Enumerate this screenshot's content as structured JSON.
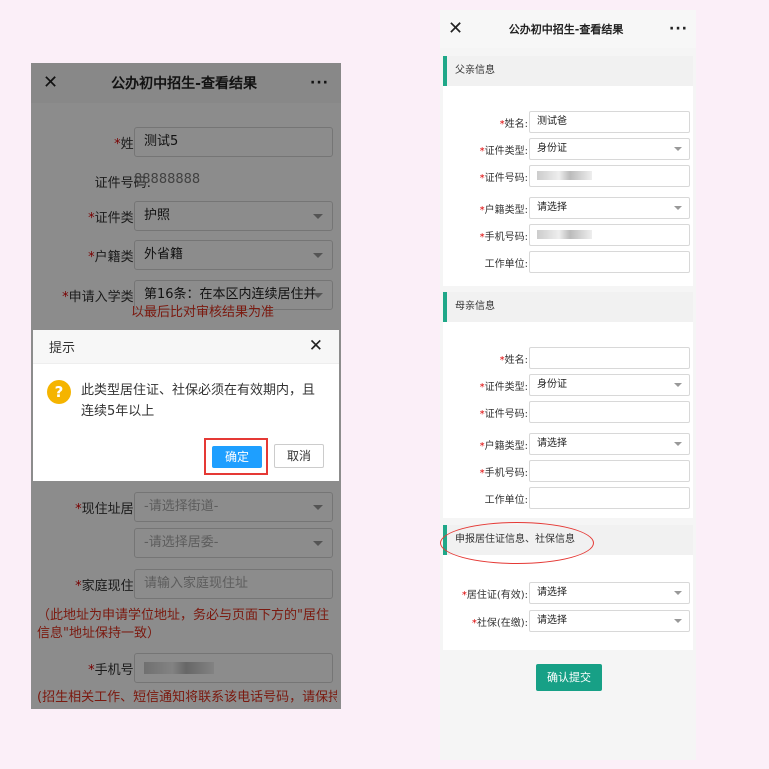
{
  "left": {
    "nav": {
      "close": "✕",
      "title": "公办初中招生-查看结果",
      "more": "···"
    },
    "form": {
      "name_label": "姓名:",
      "name_value": "测试5",
      "id_no_label": "证件号码:",
      "id_no_value": "88888888",
      "id_type_label": "证件类型:",
      "id_type_value": "护照",
      "hukou_label": "户籍类型:",
      "hukou_value": "外省籍",
      "apply_label": "申请入学类型:",
      "apply_value": "第16条：在本区内连续居住并",
      "compare_note": "以最后比对审核结果为准",
      "residence_label": "现住址居委:",
      "street_placeholder": "-请选择街道-",
      "committee_placeholder": "-请选择居委-",
      "address_label": "家庭现住址:",
      "address_placeholder": "请输入家庭现住址",
      "address_note": "（此地址为申请学位地址，务必与页面下方的\"居住信息\"地址保持一致）",
      "phone_label": "手机号码:",
      "phone_note": "(招生相关工作、短信通知将联系该电话号码，请保持畅"
    },
    "dialog": {
      "title": "提示",
      "close": "✕",
      "icon": "?",
      "message": "此类型居住证、社保必须在有效期内，且连续5年以上",
      "ok": "确定",
      "cancel": "取消"
    }
  },
  "right": {
    "nav": {
      "close": "✕",
      "title": "公办初中招生-查看结果",
      "more": "···"
    },
    "father": {
      "header": "父亲信息",
      "name_label": "姓名:",
      "name_value": "测试爸",
      "id_type_label": "证件类型:",
      "id_type_value": "身份证",
      "id_no_label": "证件号码:",
      "hukou_label": "户籍类型:",
      "hukou_placeholder": "请选择",
      "phone_label": "手机号码:",
      "work_label": "工作单位:"
    },
    "mother": {
      "header": "母亲信息",
      "name_label": "姓名:",
      "id_type_label": "证件类型:",
      "id_type_value": "身份证",
      "id_no_label": "证件号码:",
      "hukou_label": "户籍类型:",
      "hukou_placeholder": "请选择",
      "phone_label": "手机号码:",
      "work_label": "工作单位:"
    },
    "residence": {
      "header": "申报居住证信息、社保信息",
      "permit_label": "居住证(有效):",
      "permit_placeholder": "请选择",
      "social_label": "社保(在缴):",
      "social_placeholder": "请选择"
    },
    "submit": "确认提交"
  },
  "colors": {
    "accent": "#1ea888",
    "ok_button": "#1e9fff",
    "required": "#dd0000",
    "highlight": "#e53935",
    "note": "#e0301e",
    "page_bg": "#fbeff8"
  }
}
